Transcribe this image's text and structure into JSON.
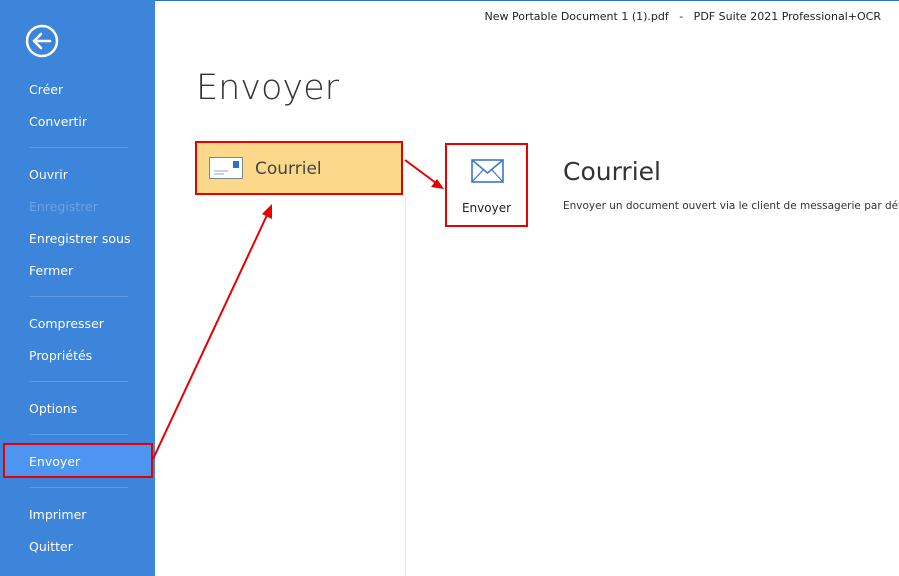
{
  "window": {
    "title": "New Portable Document 1 (1).pdf   -   PDF Suite 2021 Professional+OCR"
  },
  "sidebar": {
    "items": [
      {
        "label": "Créer"
      },
      {
        "label": "Convertir"
      },
      {
        "label": "Ouvrir"
      },
      {
        "label": "Enregistrer",
        "disabled": true
      },
      {
        "label": "Enregistrer sous"
      },
      {
        "label": "Fermer"
      },
      {
        "label": "Compresser"
      },
      {
        "label": "Propriétés"
      },
      {
        "label": "Options"
      },
      {
        "label": "Envoyer",
        "selected": true
      },
      {
        "label": "Imprimer"
      },
      {
        "label": "Quitter"
      }
    ]
  },
  "main": {
    "heading": "Envoyer",
    "options": [
      {
        "label": "Courriel",
        "selected": true
      }
    ],
    "detail": {
      "title": "Courriel",
      "description": "Envoyer un document ouvert via le client de messagerie par défaut",
      "action_label": "Envoyer"
    }
  },
  "colors": {
    "sidebar": "#3c85db",
    "sidebar_active": "#4d95f0",
    "option_selected": "#fcd98a",
    "annotation": "#e60000"
  }
}
